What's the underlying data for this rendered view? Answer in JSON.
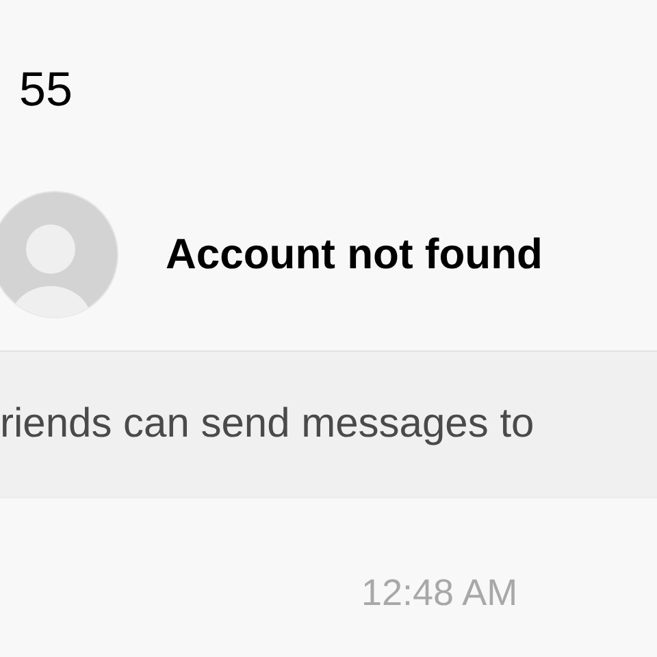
{
  "header": {
    "number": "55"
  },
  "contact": {
    "name": "Account not found"
  },
  "notice": {
    "text": "riends can send messages to"
  },
  "message": {
    "time": "12:48 AM"
  }
}
